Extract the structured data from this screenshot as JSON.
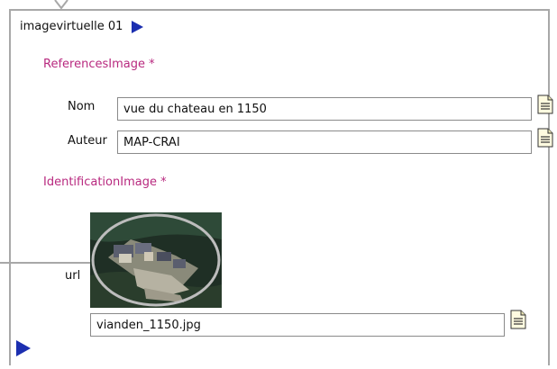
{
  "section": {
    "title": "imagevirtuelle 01"
  },
  "references": {
    "heading": "ReferencesImage *",
    "nom_label": "Nom",
    "nom_value": "vue du chateau en 1150",
    "auteur_label": "Auteur",
    "auteur_value": "MAP-CRAI"
  },
  "identification": {
    "heading": "IdentificationImage *",
    "url_label": "url",
    "file_value": "vianden_1150.jpg"
  },
  "icons": {
    "expand": "play-icon",
    "document": "document-icon"
  },
  "colors": {
    "heading": "#b8297f",
    "arrow": "#1c2fb0",
    "connector": "#a8a8a8"
  }
}
